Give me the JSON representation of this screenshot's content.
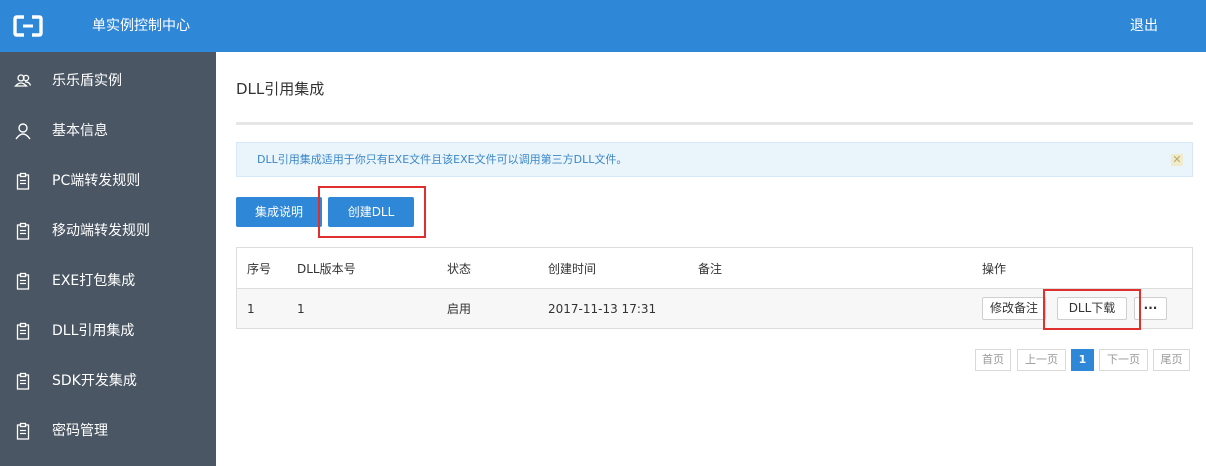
{
  "header": {
    "logo_icon": "aliyun-bracket-logo-icon",
    "title": "单实例控制中心",
    "logout_label": "退出",
    "bg_color": "#2f87d8"
  },
  "sidebar": {
    "bg_color": "#4a5663",
    "items": [
      {
        "label": "乐乐盾实例",
        "icon": "users-icon"
      },
      {
        "label": "基本信息",
        "icon": "user-icon"
      },
      {
        "label": "PC端转发规则",
        "icon": "clipboard-icon"
      },
      {
        "label": "移动端转发规则",
        "icon": "clipboard-icon"
      },
      {
        "label": "EXE打包集成",
        "icon": "clipboard-icon"
      },
      {
        "label": "DLL引用集成",
        "icon": "clipboard-icon"
      },
      {
        "label": "SDK开发集成",
        "icon": "clipboard-icon"
      },
      {
        "label": "密码管理",
        "icon": "clipboard-icon"
      }
    ]
  },
  "main": {
    "title": "DLL引用集成",
    "notice": "DLL引用集成适用于你只有EXE文件且该EXE文件可以调用第三方DLL文件。",
    "notice_close_icon": "close-icon",
    "buttons": {
      "integration_guide": "集成说明",
      "create_dll": "创建DLL"
    },
    "table": {
      "headers": [
        "序号",
        "DLL版本号",
        "状态",
        "创建时间",
        "备注",
        "操作"
      ],
      "rows": [
        {
          "index": "1",
          "version": "1",
          "status": "启用",
          "created": "2017-11-13 17:31",
          "remark": "",
          "actions": {
            "edit_remark": "修改备注",
            "download": "DLL下载",
            "more": "···"
          }
        }
      ]
    },
    "pagination": {
      "first": "首页",
      "prev": "上一页",
      "current": "1",
      "next": "下一页",
      "last": "尾页"
    }
  }
}
